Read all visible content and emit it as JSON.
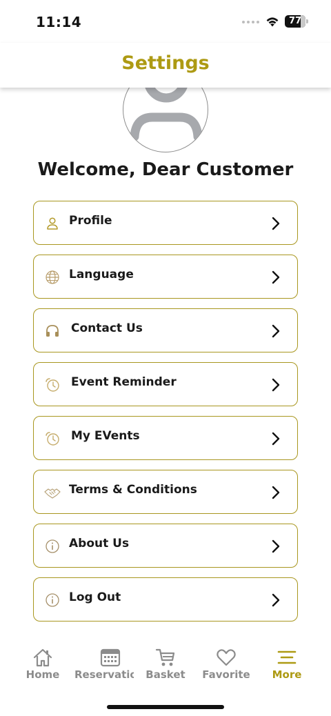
{
  "status_bar": {
    "time": "11:14",
    "battery_level": "77",
    "battery_fraction": 0.77
  },
  "header": {
    "title": "Settings"
  },
  "welcome": "Welcome, Dear Customer",
  "menu": [
    {
      "label": "Profile",
      "icon": "person-icon"
    },
    {
      "label": "Language",
      "icon": "globe-icon"
    },
    {
      "label": "Contact Us",
      "icon": "headphones-icon"
    },
    {
      "label": "Event Reminder",
      "icon": "clock-icon"
    },
    {
      "label": "My EVents",
      "icon": "clock-icon"
    },
    {
      "label": "Terms & Conditions",
      "icon": "handshake-icon"
    },
    {
      "label": "About Us",
      "icon": "info-icon"
    },
    {
      "label": "Log Out",
      "icon": "info-icon"
    }
  ],
  "tabs": [
    {
      "label": "Home",
      "icon": "home-icon",
      "active": false
    },
    {
      "label": "Reservations",
      "icon": "calendar-icon",
      "active": false
    },
    {
      "label": "Basket",
      "icon": "cart-icon",
      "active": false
    },
    {
      "label": "Favorite",
      "icon": "heart-icon",
      "active": false
    },
    {
      "label": "More",
      "icon": "menu-icon",
      "active": true
    }
  ],
  "colors": {
    "accent": "#ad9a13",
    "border": "#a8961e",
    "inactive": "#8c8c8c",
    "text": "#1a1a1a"
  }
}
